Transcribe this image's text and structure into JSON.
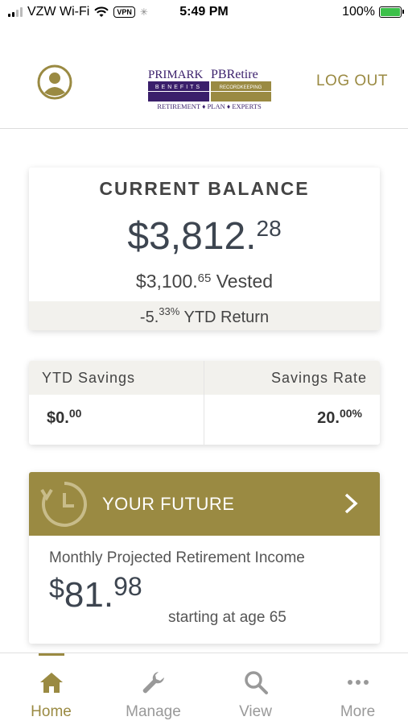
{
  "status_bar": {
    "carrier": "VZW Wi-Fi",
    "vpn": "VPN",
    "time": "5:49 PM",
    "battery": "100%"
  },
  "header": {
    "logo_left": "PRIMARK",
    "logo_left_sub": "BENEFITS",
    "logo_right": "PBRetire",
    "logo_right_sub": "RECORDKEEPING",
    "logo_tagline": "RETIREMENT ♦ PLAN ♦ EXPERTS",
    "logout": "LOG OUT"
  },
  "balance": {
    "title": "CURRENT BALANCE",
    "amount_main": "$3,812.",
    "amount_cents": "28",
    "vested_main": "$3,100.",
    "vested_cents": "65",
    "vested_label": " Vested",
    "ytd_main": "-5.",
    "ytd_decimal": "33%",
    "ytd_label": " YTD Return"
  },
  "savings": {
    "ytd_label": "YTD Savings",
    "ytd_main": "$0.",
    "ytd_cents": "00",
    "rate_label": "Savings Rate",
    "rate_main": "20.",
    "rate_decimal": "00%"
  },
  "future": {
    "title": "YOUR FUTURE",
    "monthly_label": "Monthly Projected Retirement Income",
    "currency": "$",
    "amount_main": "81.",
    "amount_cents": "98",
    "starting": "starting at age 65"
  },
  "tabs": [
    {
      "label": "Home",
      "icon": "home-icon",
      "active": true
    },
    {
      "label": "Manage",
      "icon": "wrench-icon",
      "active": false
    },
    {
      "label": "View",
      "icon": "search-icon",
      "active": false
    },
    {
      "label": "More",
      "icon": "more-icon",
      "active": false
    }
  ],
  "colors": {
    "accent": "#9a8a42",
    "logo_purple": "#3a1f6b",
    "text_dark": "#3d4550",
    "panel_bg": "#f2f1ed"
  }
}
